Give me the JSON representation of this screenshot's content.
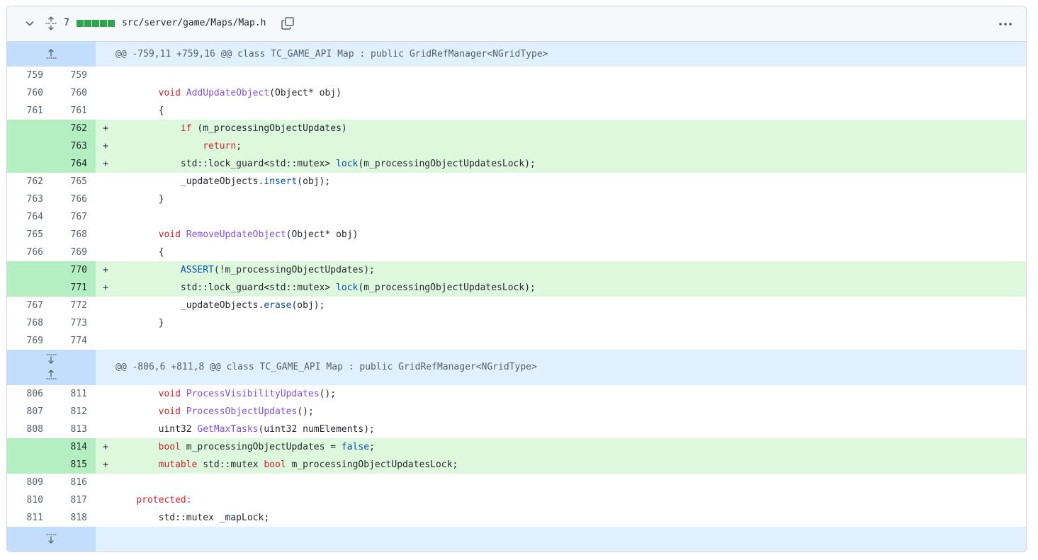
{
  "file": {
    "changes_count": "7",
    "diffstat": [
      "add",
      "add",
      "add",
      "add",
      "add"
    ],
    "path": "src/server/game/Maps/Map.h",
    "icons": {
      "collapse": "chevron-down-icon",
      "expand_all": "unfold-icon",
      "copy": "copy-icon",
      "more": "kebab-horizontal-icon"
    }
  },
  "colors": {
    "addition_gutter": "#b4efc2",
    "addition_line": "#def8de",
    "hunk_gutter": "#c3ddfd",
    "hunk_line": "#e1f0fd",
    "diffstat_green": "#2da44e"
  },
  "hunks": [
    {
      "header": "@@ -759,11 +759,16 @@ class TC_GAME_API Map : public GridRefManager<NGridType>",
      "expand": [
        "up"
      ],
      "lines": [
        {
          "old": "759",
          "new": "759",
          "type": "ctx",
          "segs": [
            [
              "",
              ""
            ]
          ]
        },
        {
          "old": "760",
          "new": "760",
          "type": "ctx",
          "segs": [
            [
              "        ",
              ""
            ],
            [
              "void",
              "kw"
            ],
            [
              " ",
              ""
            ],
            [
              "AddUpdateObject",
              "fn"
            ],
            [
              "(Object* obj)",
              ""
            ]
          ]
        },
        {
          "old": "761",
          "new": "761",
          "type": "ctx",
          "segs": [
            [
              "        {",
              ""
            ]
          ]
        },
        {
          "old": "",
          "new": "762",
          "type": "add",
          "segs": [
            [
              "            ",
              ""
            ],
            [
              "if",
              "kw"
            ],
            [
              " (m_processingObjectUpdates)",
              ""
            ]
          ]
        },
        {
          "old": "",
          "new": "763",
          "type": "add",
          "segs": [
            [
              "                ",
              ""
            ],
            [
              "return",
              "kw"
            ],
            [
              ";",
              ""
            ]
          ]
        },
        {
          "old": "",
          "new": "764",
          "type": "add",
          "segs": [
            [
              "            std::lock_guard<std::mutex> ",
              ""
            ],
            [
              "lock",
              "mt"
            ],
            [
              "(m_processingObjectUpdatesLock);",
              ""
            ]
          ]
        },
        {
          "old": "762",
          "new": "765",
          "type": "ctx",
          "segs": [
            [
              "            _updateObjects.",
              ""
            ],
            [
              "insert",
              "mt"
            ],
            [
              "(obj);",
              ""
            ]
          ]
        },
        {
          "old": "763",
          "new": "766",
          "type": "ctx",
          "segs": [
            [
              "        }",
              ""
            ]
          ]
        },
        {
          "old": "764",
          "new": "767",
          "type": "ctx",
          "segs": [
            [
              "",
              ""
            ]
          ]
        },
        {
          "old": "765",
          "new": "768",
          "type": "ctx",
          "segs": [
            [
              "        ",
              ""
            ],
            [
              "void",
              "kw"
            ],
            [
              " ",
              ""
            ],
            [
              "RemoveUpdateObject",
              "fn"
            ],
            [
              "(Object* obj)",
              ""
            ]
          ]
        },
        {
          "old": "766",
          "new": "769",
          "type": "ctx",
          "segs": [
            [
              "        {",
              ""
            ]
          ]
        },
        {
          "old": "",
          "new": "770",
          "type": "add",
          "segs": [
            [
              "            ",
              ""
            ],
            [
              "ASSERT",
              "mt"
            ],
            [
              "(!m_processingObjectUpdates);",
              ""
            ]
          ]
        },
        {
          "old": "",
          "new": "771",
          "type": "add",
          "segs": [
            [
              "            std::lock_guard<std::mutex> ",
              ""
            ],
            [
              "lock",
              "mt"
            ],
            [
              "(m_processingObjectUpdatesLock);",
              ""
            ]
          ]
        },
        {
          "old": "767",
          "new": "772",
          "type": "ctx",
          "segs": [
            [
              "            _updateObjects.",
              ""
            ],
            [
              "erase",
              "mt"
            ],
            [
              "(obj);",
              ""
            ]
          ]
        },
        {
          "old": "768",
          "new": "773",
          "type": "ctx",
          "segs": [
            [
              "        }",
              ""
            ]
          ]
        },
        {
          "old": "769",
          "new": "774",
          "type": "ctx",
          "segs": [
            [
              "",
              ""
            ]
          ]
        }
      ]
    },
    {
      "header": "@@ -806,6 +811,8 @@ class TC_GAME_API Map : public GridRefManager<NGridType>",
      "expand": [
        "down",
        "up"
      ],
      "lines": [
        {
          "old": "806",
          "new": "811",
          "type": "ctx",
          "segs": [
            [
              "        ",
              ""
            ],
            [
              "void",
              "kw"
            ],
            [
              " ",
              ""
            ],
            [
              "ProcessVisibilityUpdates",
              "fn"
            ],
            [
              "();",
              ""
            ]
          ]
        },
        {
          "old": "807",
          "new": "812",
          "type": "ctx",
          "segs": [
            [
              "        ",
              ""
            ],
            [
              "void",
              "kw"
            ],
            [
              " ",
              ""
            ],
            [
              "ProcessObjectUpdates",
              "fn"
            ],
            [
              "();",
              ""
            ]
          ]
        },
        {
          "old": "808",
          "new": "813",
          "type": "ctx",
          "segs": [
            [
              "        uint32 ",
              ""
            ],
            [
              "GetMaxTasks",
              "fn"
            ],
            [
              "(uint32 numElements);",
              ""
            ]
          ]
        },
        {
          "old": "",
          "new": "814",
          "type": "add",
          "segs": [
            [
              "        ",
              ""
            ],
            [
              "bool",
              "kw"
            ],
            [
              " m_processingObjectUpdates = ",
              ""
            ],
            [
              "false",
              "mt"
            ],
            [
              ";",
              ""
            ]
          ]
        },
        {
          "old": "",
          "new": "815",
          "type": "add",
          "segs": [
            [
              "        ",
              ""
            ],
            [
              "mutable",
              "kw"
            ],
            [
              " std::mutex ",
              ""
            ],
            [
              "bool",
              "kw"
            ],
            [
              " m_processingObjectUpdatesLock;",
              ""
            ]
          ]
        },
        {
          "old": "809",
          "new": "816",
          "type": "ctx",
          "segs": [
            [
              "",
              ""
            ]
          ]
        },
        {
          "old": "810",
          "new": "817",
          "type": "ctx",
          "segs": [
            [
              "    ",
              ""
            ],
            [
              "protected:",
              "kw"
            ]
          ]
        },
        {
          "old": "811",
          "new": "818",
          "type": "ctx",
          "segs": [
            [
              "        std::mutex _mapLock;",
              ""
            ]
          ]
        }
      ]
    },
    {
      "header": "",
      "expand": [
        "down"
      ],
      "lines": []
    }
  ]
}
